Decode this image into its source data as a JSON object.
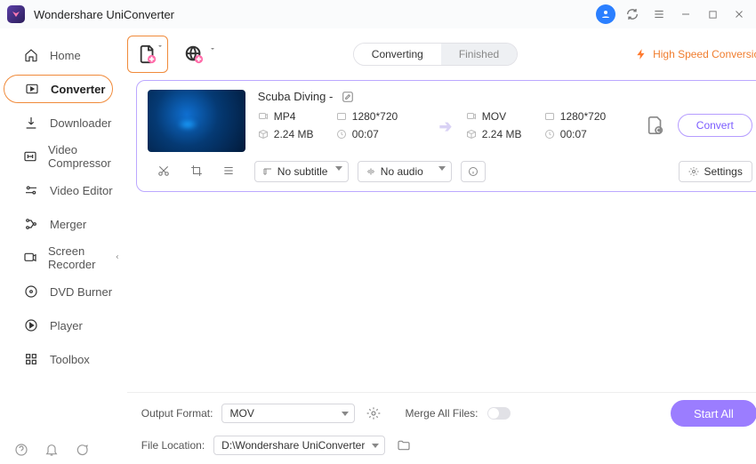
{
  "app": {
    "title": "Wondershare UniConverter"
  },
  "sidebar": {
    "items": [
      {
        "label": "Home"
      },
      {
        "label": "Converter"
      },
      {
        "label": "Downloader"
      },
      {
        "label": "Video Compressor"
      },
      {
        "label": "Video Editor"
      },
      {
        "label": "Merger"
      },
      {
        "label": "Screen Recorder"
      },
      {
        "label": "DVD Burner"
      },
      {
        "label": "Player"
      },
      {
        "label": "Toolbox"
      }
    ]
  },
  "tabs": {
    "converting": "Converting",
    "finished": "Finished"
  },
  "badge": {
    "hsc": "High Speed Conversion"
  },
  "task": {
    "title": "Scuba Diving -",
    "src": {
      "format": "MP4",
      "resolution": "1280*720",
      "size": "2.24 MB",
      "duration": "00:07"
    },
    "dst": {
      "format": "MOV",
      "resolution": "1280*720",
      "size": "2.24 MB",
      "duration": "00:07"
    },
    "subtitle": "No subtitle",
    "audio": "No audio",
    "settings_label": "Settings",
    "convert_label": "Convert"
  },
  "footer": {
    "output_format_label": "Output Format:",
    "output_format_value": "MOV",
    "file_location_label": "File Location:",
    "file_location_value": "D:\\Wondershare UniConverter",
    "merge_label": "Merge All Files:",
    "start_all": "Start All"
  }
}
